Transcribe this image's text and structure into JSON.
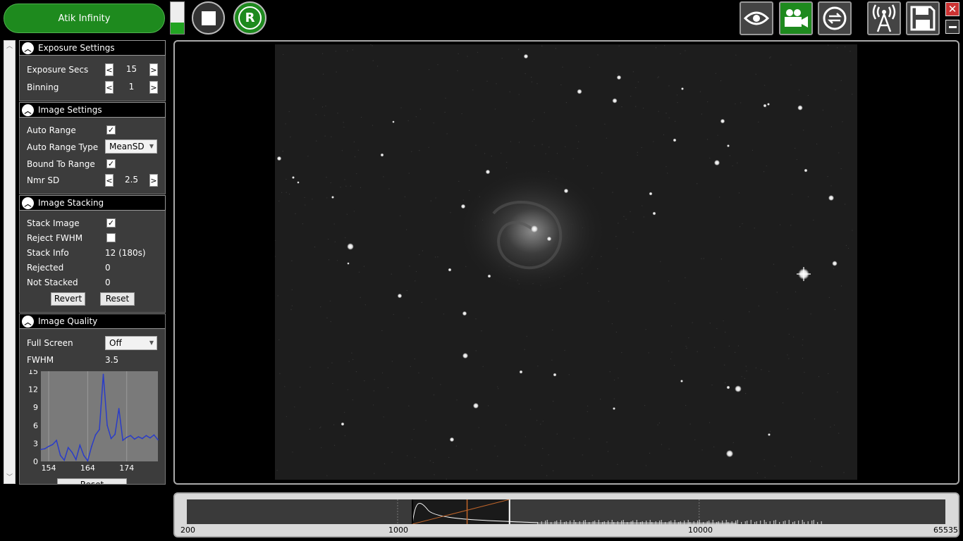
{
  "app": {
    "camera_button_label": "Atik Infinity",
    "level_meter_fraction": 0.35
  },
  "toolbar": {
    "stop_icon": "stop-icon",
    "record_icon": "record-icon",
    "record_label": "R",
    "right_icons": [
      "eye-icon",
      "video-camera-icon",
      "swap-icon",
      "antenna-icon",
      "save-icon"
    ],
    "close_label": "✕"
  },
  "exposure": {
    "title": "Exposure Settings",
    "exposure_secs_label": "Exposure Secs",
    "exposure_secs_value": "15",
    "binning_label": "Binning",
    "binning_value": "1",
    "dec_label": "<",
    "inc_label": ">"
  },
  "image_settings": {
    "title": "Image Settings",
    "auto_range_label": "Auto Range",
    "auto_range_checked": true,
    "auto_range_type_label": "Auto Range Type",
    "auto_range_type_value": "MeanSD",
    "bound_label": "Bound To Range",
    "bound_checked": true,
    "nmr_sd_label": "Nmr SD",
    "nmr_sd_value": "2.5"
  },
  "stacking": {
    "title": "Image Stacking",
    "stack_image_label": "Stack Image",
    "stack_image_checked": true,
    "reject_fwhm_label": "Reject FWHM",
    "reject_fwhm_checked": false,
    "stack_info_label": "Stack Info",
    "stack_info_value": "12 (180s)",
    "rejected_label": "Rejected",
    "rejected_value": "0",
    "not_stacked_label": "Not Stacked",
    "not_stacked_value": "0",
    "revert_label": "Revert",
    "reset_label": "Reset"
  },
  "quality": {
    "title": "Image Quality",
    "full_screen_label": "Full Screen",
    "full_screen_value": "Off",
    "fwhm_label": "FWHM",
    "fwhm_value": "3.5",
    "bottom_button_label": "Reset"
  },
  "chart_data": {
    "type": "line",
    "title": "",
    "xlabel": "",
    "ylabel": "",
    "xlim": [
      152,
      182
    ],
    "ylim": [
      0,
      15
    ],
    "x_ticks": [
      "154",
      "164",
      "174"
    ],
    "y_ticks": [
      "0",
      "3",
      "6",
      "9",
      "12",
      "15"
    ],
    "series": [
      {
        "color": "#2a3cc8",
        "x": [
          152,
          153,
          154,
          155,
          156,
          157,
          158,
          159,
          160,
          161,
          162,
          163,
          164,
          165,
          166,
          167,
          168,
          169,
          170,
          171,
          172,
          173,
          174,
          175,
          176,
          177,
          178,
          179,
          180,
          181,
          182
        ],
        "y": [
          2.0,
          2.1,
          2.5,
          2.8,
          3.5,
          1.0,
          0.2,
          2.3,
          1.5,
          0.3,
          2.7,
          1.0,
          0.1,
          2.5,
          4.4,
          5.3,
          14.5,
          6.0,
          3.8,
          4.5,
          8.8,
          3.5,
          4.0,
          4.3,
          3.7,
          4.1,
          3.8,
          4.3,
          3.9,
          4.4,
          3.6
        ]
      }
    ]
  },
  "histogram": {
    "tick_labels": [
      "200",
      "1000",
      "10000",
      "65535"
    ],
    "log_min": 200,
    "log_max": 65535,
    "black_point": 1120,
    "white_point": 2350,
    "mid_point": 1700
  },
  "colors": {
    "accent_green": "#1e8a1e",
    "sky_background": "#1d1d1d",
    "fwhm_line": "#2a3cc8",
    "histogram_mid": "#c0652a"
  }
}
